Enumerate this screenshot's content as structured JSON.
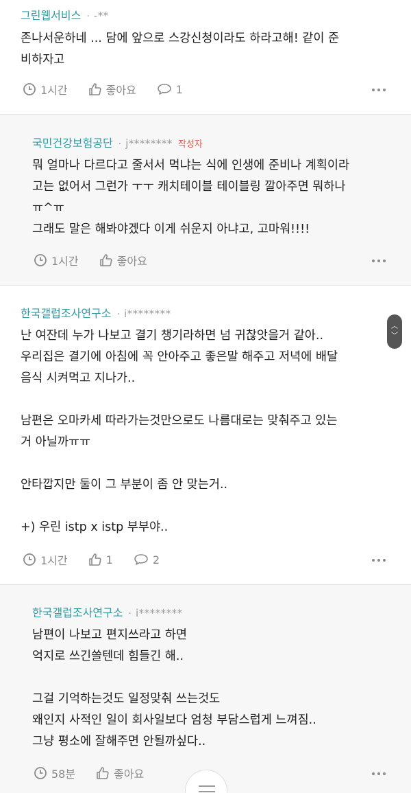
{
  "comments": [
    {
      "author": "그린웹서비스",
      "masked_id": "-**",
      "lines": [
        "존나서운하네 ... 담에 앞으로 스강신청이라도 하라고해! 같이 준",
        "비하자고"
      ],
      "time": "1시간",
      "like_label": "좋아요",
      "reply_count": "1"
    },
    {
      "author": "국민건강보험공단",
      "masked_id": "j********",
      "writer_tag": "작성자",
      "lines": [
        "뭐 얼마나 다르다고 줄서서 먹냐는 식에 인생에 준비나 계획이라",
        "고는 없어서 그런가 ㅜㅜ 캐치테이블 테이블링 깔아주면 뭐하나",
        "ㅠ^ㅠ",
        "그래도 말은 해봐야겠다 이게 쉬운지 아냐고, 고마워!!!!"
      ],
      "time": "1시간",
      "like_label": "좋아요"
    },
    {
      "author": "한국갤럽조사연구소",
      "masked_id": "i********",
      "lines": [
        "난 여잔데 누가 나보고 결기 챙기라하면 넘 귀찮앗을거 같아..",
        "우리집은 결기에 아침에 꼭 안아주고 좋은말 해주고 저녁에 배달",
        "음식 시켜먹고 지나가..",
        "",
        "남편은 오마카세 따라가는것만으로도 나름대로는 맞춰주고 있는",
        "거 아닐까ㅠㅠ",
        "",
        "안타깝지만 둘이 그 부분이 좀 안 맞는거..",
        "",
        "+) 우린 istp x istp 부부야.."
      ],
      "time": "1시간",
      "like_count": "1",
      "reply_count": "2"
    },
    {
      "author": "한국갤럽조사연구소",
      "masked_id": "i********",
      "lines": [
        "남편이 나보고 편지쓰라고 하면",
        "억지로 쓰긴쓸텐데 힘들긴 해..",
        "",
        "그걸 기억하는것도 일정맞춰 쓰는것도",
        "왜인지 사적인 일이 회사일보다 엄청 부담스럽게 느껴짐..",
        "그냥 평소에 잘해주면 안될까싶다.."
      ],
      "time": "58분",
      "like_label": "좋아요"
    }
  ],
  "colors": {
    "author": "#2f9aa4",
    "writer_tag": "#e05a4a",
    "muted": "#8a8a8a",
    "reply_bg": "#f7f7f7"
  },
  "icons": [
    "clock-icon",
    "thumbs-up-icon",
    "speech-bubble-icon",
    "more-dots-icon",
    "scroll-up-icon",
    "scroll-down-icon"
  ]
}
